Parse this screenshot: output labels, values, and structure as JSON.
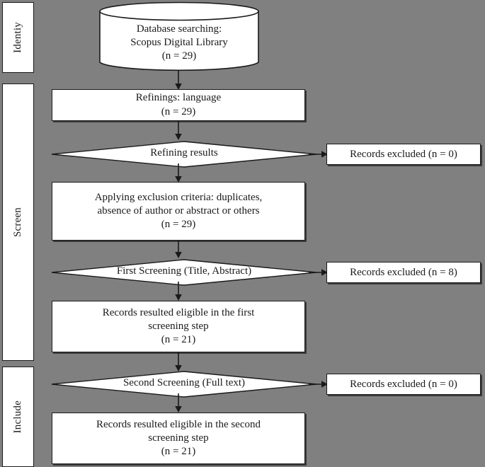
{
  "diagram": {
    "type": "prisma-flow-diagram",
    "background_color": "#808080",
    "shape_fill": "#ffffff",
    "line_color": "#1a1a1a",
    "phases": [
      {
        "id": "identification",
        "label": "Identiy"
      },
      {
        "id": "screening",
        "label": "Screen"
      },
      {
        "id": "included",
        "label": "Include"
      }
    ],
    "nodes": [
      {
        "id": "database-searching",
        "shape": "cylinder",
        "lines": [
          "Database searching:",
          "Scopus Digital Library",
          "(n = 29)"
        ],
        "count": 29
      },
      {
        "id": "refinings-language",
        "shape": "process",
        "lines": [
          "Refinings: language",
          "(n = 29)"
        ],
        "count": 29
      },
      {
        "id": "refining-results",
        "shape": "decision",
        "lines": [
          "Refining results"
        ]
      },
      {
        "id": "records-excluded-1",
        "shape": "process",
        "lines": [
          "Records excluded (n = 0)"
        ],
        "count": 0
      },
      {
        "id": "applying-exclusion-criteria",
        "shape": "process",
        "lines": [
          "Applying exclusion criteria: duplicates,",
          "absence of author or abstract or others",
          "(n = 29)"
        ],
        "count": 29
      },
      {
        "id": "first-screening",
        "shape": "decision",
        "lines": [
          "First Screening (Title, Abstract)"
        ]
      },
      {
        "id": "records-excluded-2",
        "shape": "process",
        "lines": [
          "Records excluded (n = 8)"
        ],
        "count": 8
      },
      {
        "id": "eligible-first-screening",
        "shape": "process",
        "lines": [
          "Records resulted eligible in the first",
          "screening step",
          "(n = 21)"
        ],
        "count": 21
      },
      {
        "id": "second-screening",
        "shape": "decision",
        "lines": [
          "Second Screening (Full text)"
        ]
      },
      {
        "id": "records-excluded-3",
        "shape": "process",
        "lines": [
          "Records excluded (n = 0)"
        ],
        "count": 0
      },
      {
        "id": "eligible-second-screening",
        "shape": "process",
        "lines": [
          "Records resulted eligible in the second",
          "screening step",
          "(n = 21)"
        ],
        "count": 21
      }
    ]
  }
}
